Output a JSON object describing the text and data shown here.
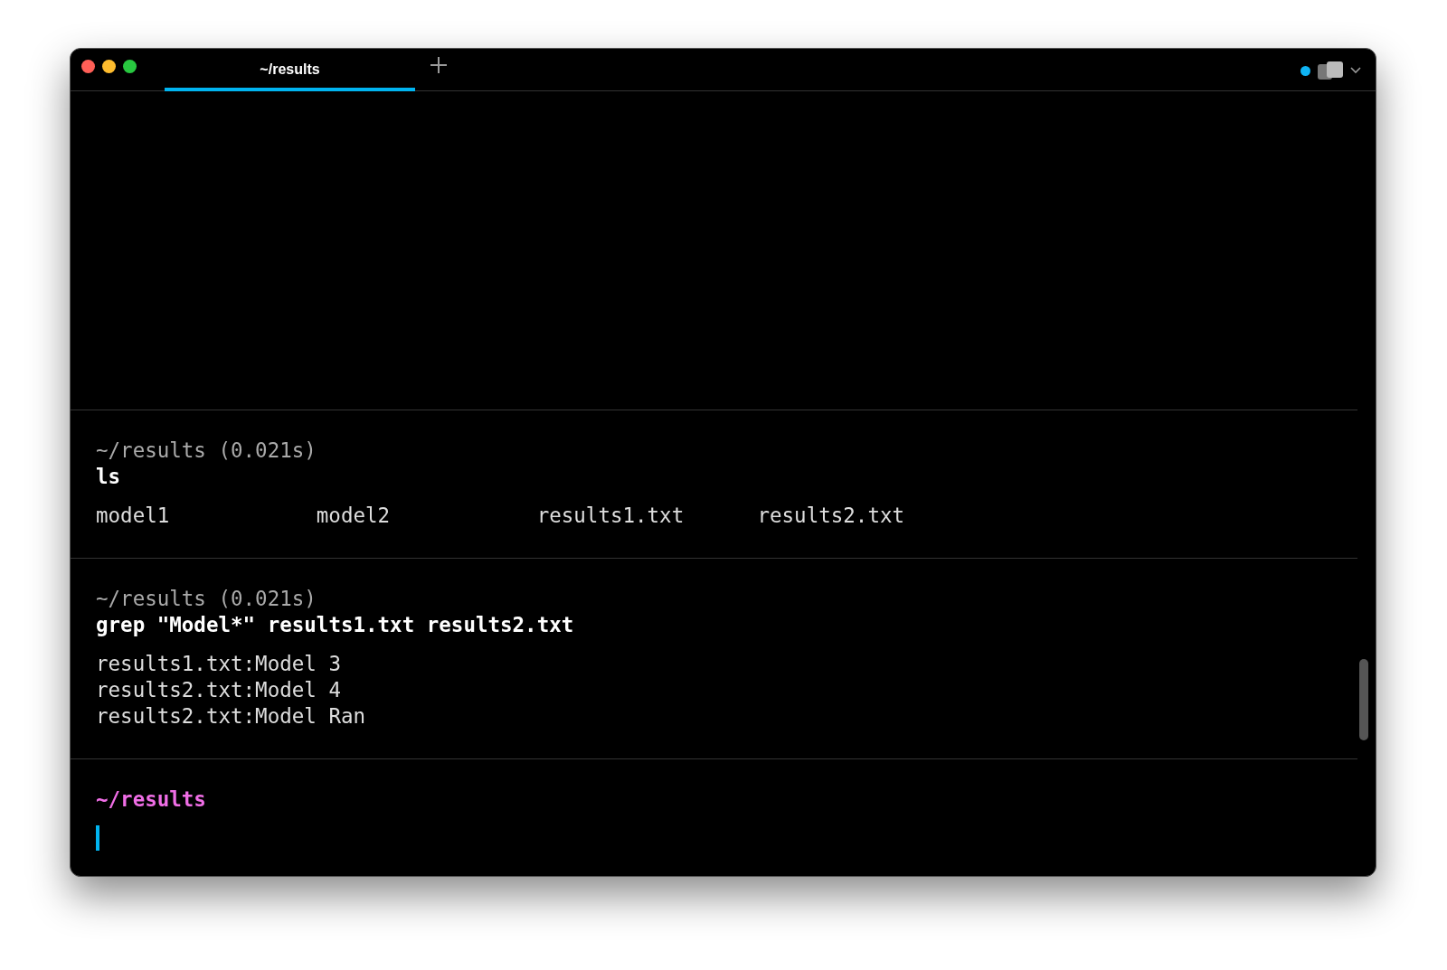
{
  "window": {
    "tabs": [
      {
        "label": "~/results",
        "selected": true
      }
    ]
  },
  "blocks": [
    {
      "header": "~/results (0.021s)",
      "command": "ls",
      "output_rows": [
        [
          "model1",
          "model2",
          "results1.txt",
          "results2.txt"
        ]
      ]
    },
    {
      "header": "~/results (0.021s)",
      "command": "grep \"Model*\" results1.txt results2.txt",
      "output_rows": [
        [
          "results1.txt:Model 3"
        ],
        [
          "results2.txt:Model 4"
        ],
        [
          "results2.txt:Model Ran"
        ]
      ]
    }
  ],
  "prompt": {
    "path": "~/results"
  }
}
